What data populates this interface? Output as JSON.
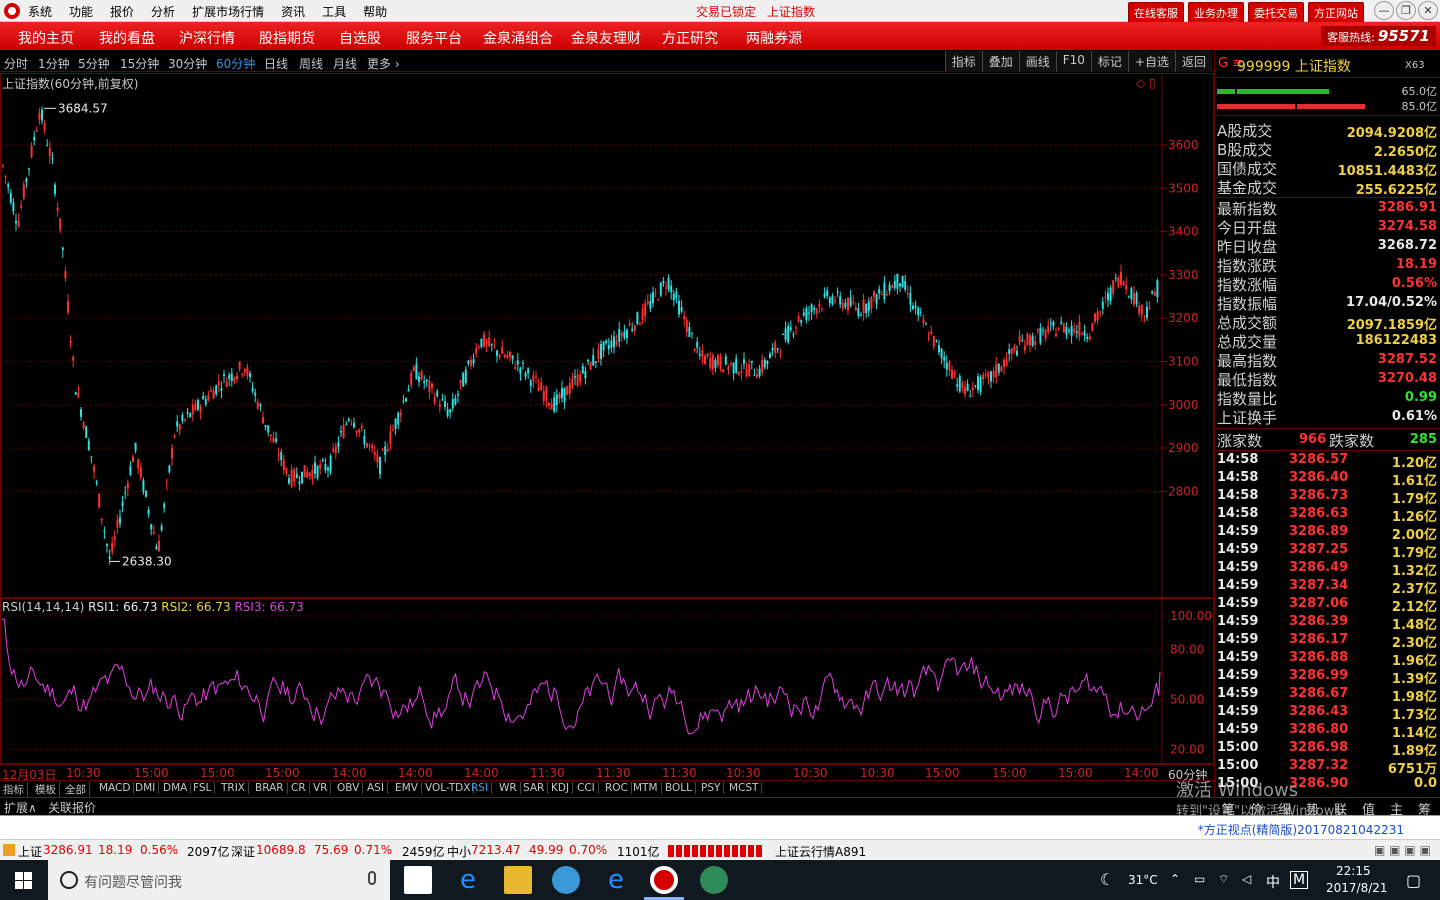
{
  "menu": [
    "系统",
    "功能",
    "报价",
    "分析",
    "扩展市场行情",
    "资讯",
    "工具",
    "帮助"
  ],
  "status": {
    "lock": "交易已锁定",
    "index": "上证指数"
  },
  "top_buttons": [
    "在线客服",
    "业务办理",
    "委托交易",
    "方正网站"
  ],
  "nav": [
    "我的主页",
    "我的看盘",
    "沪深行情",
    "股指期货",
    "自选股",
    "服务平台",
    "金泉涌组合",
    "金泉友理财",
    "方正研究",
    "两融券源"
  ],
  "hotline": {
    "label": "客服热线:",
    "number": "95571"
  },
  "periods": [
    "分时",
    "1分钟",
    "5分钟",
    "15分钟",
    "30分钟",
    "60分钟",
    "日线",
    "周线",
    "月线",
    "更多 ›"
  ],
  "active_period": "60分钟",
  "tools": [
    "指标",
    "叠加",
    "画线",
    "F10",
    "标记",
    "+自选",
    "返回"
  ],
  "main_chart": {
    "title": "上证指数(60分钟,前复权)",
    "y_ticks": [
      "3600",
      "3500",
      "3400",
      "3300",
      "3200",
      "3100",
      "3000",
      "2900",
      "2800"
    ],
    "high_label": "3684.57",
    "low_label": "2638.30"
  },
  "rsi_chart": {
    "title": "RSI(14,14,14)",
    "rsi1": "RSI1: 66.73",
    "rsi2": "RSI2: 66.73",
    "rsi3": "RSI3: 66.73",
    "y_ticks": [
      "100.00",
      "80.00",
      "50.00",
      "20.00"
    ]
  },
  "time_axis": [
    "12月03日",
    "10:30",
    "15:00",
    "15:00",
    "15:00",
    "14:00",
    "14:00",
    "14:00",
    "11:30",
    "11:30",
    "11:30",
    "10:30",
    "10:30",
    "10:30",
    "15:00",
    "15:00",
    "15:00",
    "14:00"
  ],
  "time_axis_unit": "60分钟",
  "indicator_tabs": [
    "指标",
    "模板",
    "全部",
    "MACD",
    "DMI",
    "DMA",
    "FSL",
    "TRIX",
    "BRAR",
    "CR",
    "VR",
    "OBV",
    "ASI",
    "EMV",
    "VOL-TDX",
    "RSI",
    "WR",
    "SAR",
    "KDJ",
    "CCI",
    "ROC",
    "MTM",
    "BOLL",
    "PSY",
    "MCST"
  ],
  "active_indicator": "RSI",
  "bottom_left": [
    "扩展∧",
    "关联报价"
  ],
  "quote": {
    "code": "999999",
    "name": "上证指数",
    "tag": "X63",
    "bar1_label": "65.0亿",
    "bar2_label": "85.0亿",
    "turnover": [
      {
        "k": "A股成交",
        "v": "2094.9208亿"
      },
      {
        "k": "B股成交",
        "v": "2.2650亿"
      },
      {
        "k": "国债成交",
        "v": "10851.4483亿"
      },
      {
        "k": "基金成交",
        "v": "255.6225亿"
      }
    ],
    "stats": [
      {
        "k": "最新指数",
        "v": "3286.91",
        "c": "#ff3030"
      },
      {
        "k": "今日开盘",
        "v": "3274.58",
        "c": "#ff3030"
      },
      {
        "k": "昨日收盘",
        "v": "3268.72",
        "c": "#e8e8e8"
      },
      {
        "k": "指数涨跌",
        "v": "18.19",
        "c": "#ff3030"
      },
      {
        "k": "指数涨幅",
        "v": "0.56%",
        "c": "#ff3030"
      },
      {
        "k": "指数振幅",
        "v": "17.04/0.52%",
        "c": "#e8e8e8"
      },
      {
        "k": "总成交额",
        "v": "2097.1859亿",
        "c": "#f0d040"
      },
      {
        "k": "总成交量",
        "v": "186122483",
        "c": "#f0d040"
      },
      {
        "k": "最高指数",
        "v": "3287.52",
        "c": "#ff3030"
      },
      {
        "k": "最低指数",
        "v": "3270.48",
        "c": "#ff3030"
      },
      {
        "k": "指数量比",
        "v": "0.99",
        "c": "#30e030"
      },
      {
        "k": "上证换手",
        "v": "0.61%",
        "c": "#e8e8e8"
      }
    ],
    "up_label": "涨家数",
    "up": "966",
    "down_label": "跌家数",
    "down": "285",
    "ticks": [
      {
        "t": "14:58",
        "p": "3286.57",
        "v": "1.20亿"
      },
      {
        "t": "14:58",
        "p": "3286.40",
        "v": "1.61亿"
      },
      {
        "t": "14:58",
        "p": "3286.73",
        "v": "1.79亿"
      },
      {
        "t": "14:58",
        "p": "3286.63",
        "v": "1.26亿"
      },
      {
        "t": "14:59",
        "p": "3286.89",
        "v": "2.00亿"
      },
      {
        "t": "14:59",
        "p": "3287.25",
        "v": "1.79亿"
      },
      {
        "t": "14:59",
        "p": "3286.49",
        "v": "1.32亿"
      },
      {
        "t": "14:59",
        "p": "3287.34",
        "v": "2.37亿"
      },
      {
        "t": "14:59",
        "p": "3287.06",
        "v": "2.12亿"
      },
      {
        "t": "14:59",
        "p": "3286.39",
        "v": "1.48亿"
      },
      {
        "t": "14:59",
        "p": "3286.17",
        "v": "2.30亿"
      },
      {
        "t": "14:59",
        "p": "3286.88",
        "v": "1.96亿"
      },
      {
        "t": "14:59",
        "p": "3286.99",
        "v": "1.39亿"
      },
      {
        "t": "14:59",
        "p": "3286.67",
        "v": "1.98亿"
      },
      {
        "t": "14:59",
        "p": "3286.43",
        "v": "1.73亿"
      },
      {
        "t": "14:59",
        "p": "3286.80",
        "v": "1.14亿"
      },
      {
        "t": "15:00",
        "p": "3286.98",
        "v": "1.89亿"
      },
      {
        "t": "15:00",
        "p": "3287.32",
        "v": "6751万"
      },
      {
        "t": "15:00",
        "p": "3286.90",
        "v": "0.0"
      }
    ],
    "bottom_tabs": [
      "笔",
      "价",
      "细",
      "势",
      "联",
      "值",
      "主",
      "筹"
    ]
  },
  "news": "*方正视点(精简版)20170821042231",
  "statusbar": {
    "sh_label": "上证",
    "sh": "3286.91",
    "sh_chg": "18.19",
    "sh_pct": "0.56%",
    "sh_amt": "2097亿",
    "sz_label": "深证",
    "sz": "10689.8",
    "sz_chg": "75.69",
    "sz_pct": "0.71%",
    "sz_amt": "2459亿",
    "zx_label": "中小",
    "zx": "7213.47",
    "zx_chg": "49.99",
    "zx_pct": "0.70%",
    "zx_amt": "1101亿",
    "cloud": "上证云行情A891"
  },
  "watermark": {
    "line1": "激活 Windows",
    "line2": "转到\"设置\"以激活 Windows。"
  },
  "taskbar": {
    "search": "有问题尽管问我",
    "temp": "31°C",
    "ime": "中",
    "time": "22:15",
    "date": "2017/8/21"
  },
  "colors": {
    "up": "#ff3030",
    "down": "#30e0e0",
    "rsi": "#e040e0",
    "accent": "#d40000"
  }
}
